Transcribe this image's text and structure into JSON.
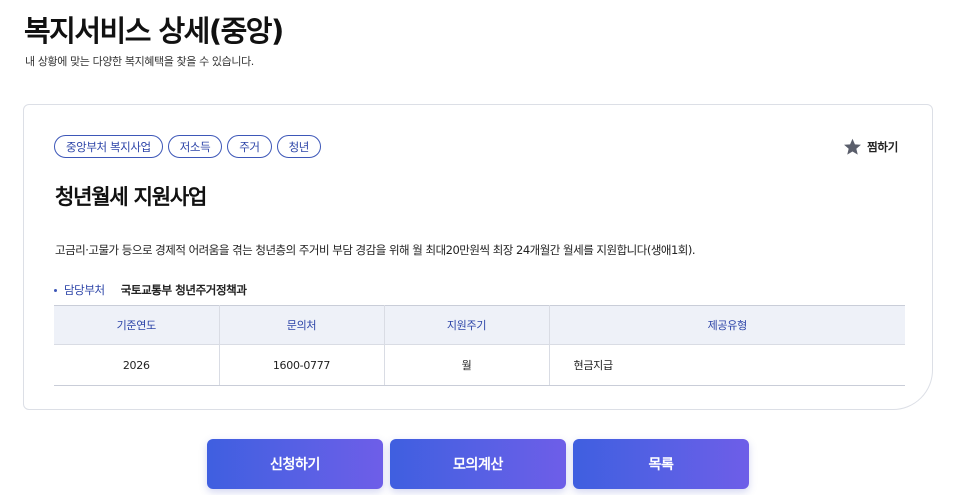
{
  "page": {
    "title": "복지서비스 상세(중앙)",
    "subtitle": "내 상황에 맞는 다양한 복지혜택을 찾을 수 있습니다."
  },
  "program": {
    "tags": [
      "중앙부처 복지사업",
      "저소득",
      "주거",
      "청년"
    ],
    "bookmark_label": "찜하기",
    "title": "청년월세 지원사업",
    "description": "고금리·고물가 등으로 경제적 어려움을 겪는 청년층의 주거비 부담 경감을 위해 월 최대20만원씩 최장 24개월간 월세를 지원합니다(생애1회).",
    "department_label": "담당부처",
    "department_value": "국토교통부 청년주거정책과"
  },
  "table": {
    "headers": [
      "기준연도",
      "문의처",
      "지원주기",
      "제공유형"
    ],
    "row": [
      "2026",
      "1600-0777",
      "월",
      "현금지급"
    ]
  },
  "actions": {
    "apply_label": "신청하기",
    "simulate_label": "모의계산",
    "list_label": "목록"
  },
  "icons": {
    "bookmark": "star-icon"
  },
  "colors": {
    "accent": "#2d45a8",
    "button_gradient_start": "#3f5fe0",
    "button_gradient_end": "#6e5ee8",
    "table_header_bg": "#eef1f8"
  }
}
